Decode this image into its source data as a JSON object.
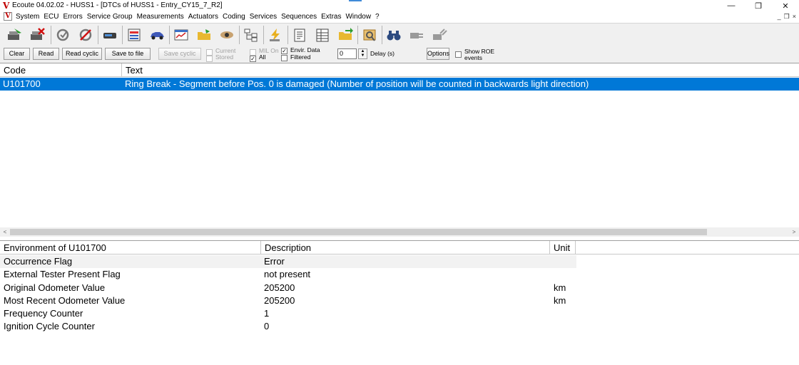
{
  "window": {
    "title": "Ecoute 04.02.02 - HUSS1 - [DTCs of HUSS1 - Entry_CY15_7_R2]",
    "logo_letter": "V",
    "controls": {
      "minimize": "—",
      "restore": "❐",
      "close": "✕"
    },
    "accent_color": "#3f8ad8"
  },
  "menu": {
    "items": [
      "System",
      "ECU",
      "Errors",
      "Service Group",
      "Measurements",
      "Actuators",
      "Coding",
      "Services",
      "Sequences",
      "Extras",
      "Window",
      "?"
    ],
    "mdi_controls": [
      "_",
      "❒",
      "×"
    ]
  },
  "toolbar": {
    "icons": [
      "connect-icon",
      "disconnect-icon",
      "refresh-icon",
      "stop-refresh-icon",
      "ecu-icon",
      "ecu-list-icon",
      "vehicle-icon",
      "chart-icon",
      "open-folder-icon",
      "eye-icon",
      "tree-icon",
      "flash-icon",
      "document-icon",
      "table-icon",
      "folder-arrow-icon",
      "settings-icon",
      "binoculars-icon",
      "plug-icon",
      "unplug-icon"
    ]
  },
  "controls": {
    "clear_label": "Clear",
    "read_label": "Read",
    "read_cyclic_label": "Read cyclic",
    "save_to_file_label": "Save to file",
    "save_cyclic_label": "Save cyclic",
    "current_label": "Current",
    "stored_label": "Stored",
    "mil_on_label": "MIL On",
    "all_label": "All",
    "envir_data_label": "Envir. Data",
    "filtered_label": "Filtered",
    "delay_value": "0",
    "delay_label": "Delay (s)",
    "options_label": "Options",
    "show_roe_label": "Show ROE",
    "events_label": "events",
    "check_mark": "✓",
    "all_checked": true,
    "envir_data_checked": true
  },
  "dtc_table": {
    "columns": [
      "Code",
      "Text"
    ],
    "rows": [
      {
        "code": "U101700",
        "text": "Ring Break - Segment before Pos. 0 is damaged (Number of position will be counted in backwards light direction)"
      }
    ],
    "selection_color": "#0078d7"
  },
  "scrollbar": {
    "left_arrow": "<",
    "right_arrow": ">"
  },
  "env_table": {
    "columns": [
      "Environment of U101700",
      "Description",
      "Unit"
    ],
    "rows": [
      {
        "name": "Occurrence Flag",
        "description": "Error",
        "unit": ""
      },
      {
        "name": "External Tester Present Flag",
        "description": "not present",
        "unit": ""
      },
      {
        "name": "Original Odometer Value",
        "description": "205200",
        "unit": "km"
      },
      {
        "name": "Most Recent Odometer Value",
        "description": "205200",
        "unit": "km"
      },
      {
        "name": "Frequency Counter",
        "description": "1",
        "unit": ""
      },
      {
        "name": "Ignition Cycle Counter",
        "description": "0",
        "unit": ""
      }
    ]
  }
}
